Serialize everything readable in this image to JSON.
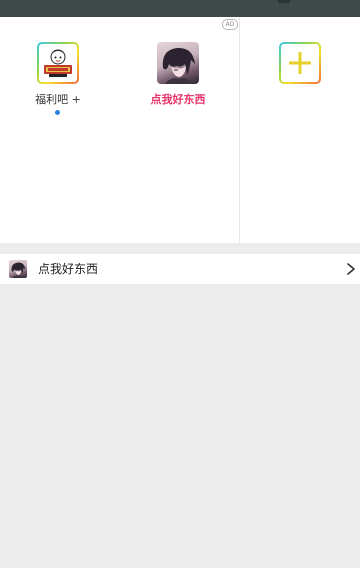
{
  "ad_badge": "AD",
  "apps": [
    {
      "label": "福利吧 +",
      "icon": "welfare-bar-icon"
    },
    {
      "label": "点我好东西",
      "icon": "anime-avatar-icon",
      "color": "#e8336b"
    }
  ],
  "add_button": {
    "icon": "plus-icon",
    "color": "#e6d12a"
  },
  "list": {
    "items": [
      {
        "label": "点我好东西",
        "icon": "anime-avatar-icon"
      }
    ]
  },
  "colors": {
    "status_bar": "#3d4a48",
    "page_indicator": "#2d7fde",
    "background": "#ececec"
  }
}
